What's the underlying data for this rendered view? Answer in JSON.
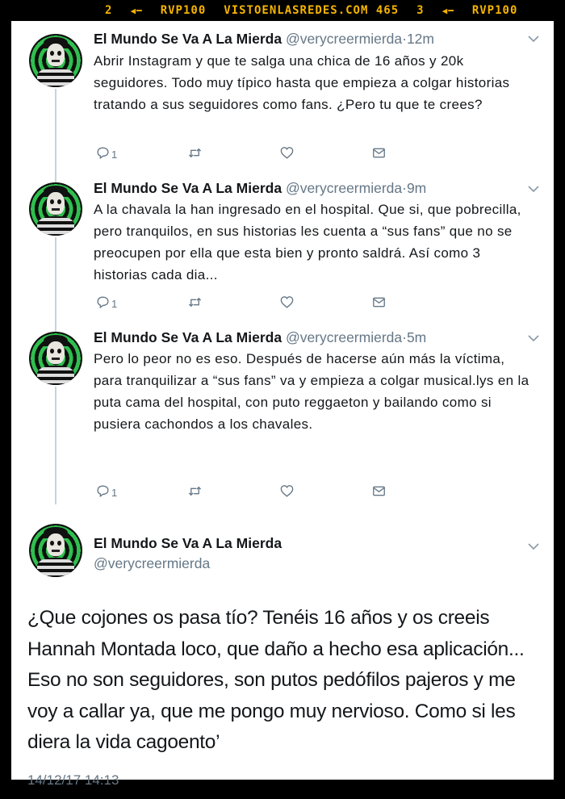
{
  "ticker": {
    "item1_num": "2",
    "item1_label": "RVP100",
    "site": "VISTOENLASREDES.COM 465",
    "item2_num": "3",
    "item2_label": "RVP100"
  },
  "tweets": [
    {
      "name": "El Mundo Se Va A La Mierda",
      "handle": "@verycreermierda",
      "time": "12m",
      "text": "Abrir Instagram y que te salga una chica de 16 años y 20k seguidores. Todo muy típico hasta que empieza a colgar historias tratando a sus seguidores como fans. ¿Pero tu que te crees?",
      "replies": "1"
    },
    {
      "name": "El Mundo Se Va A La Mierda",
      "handle": "@verycreermierda",
      "time": "9m",
      "text": "A la chavala la han ingresado en el hospital. Que si, que pobrecilla, pero tranquilos, en sus historias les cuenta a “sus fans” que no se preocupen por ella que esta bien y pronto saldrá. Así como 3 historias cada dia...",
      "replies": "1"
    },
    {
      "name": "El Mundo Se Va A La Mierda",
      "handle": "@verycreermierda",
      "time": "5m",
      "text": "Pero lo peor no es eso. Después de hacerse aún más la víctima, para tranquilizar a “sus fans” va y empieza a colgar musical.lys en la puta cama del hospital, con puto reggaeton y bailando como si pusiera cachondos a los chavales.",
      "replies": "1"
    }
  ],
  "main_tweet": {
    "name": "El Mundo Se Va A La Mierda",
    "handle": "@verycreermierda",
    "text": "¿Que cojones os pasa tío? Tenéis 16 años y os creeis Hannah Montada loco, que daño a hecho esa aplicación... Eso no son seguidores, son putos pedófilos pajeros y me voy a callar ya, que me pongo muy nervioso. Como si les diera la vida cagoento’",
    "timestamp": "14/12/17 14:13"
  }
}
